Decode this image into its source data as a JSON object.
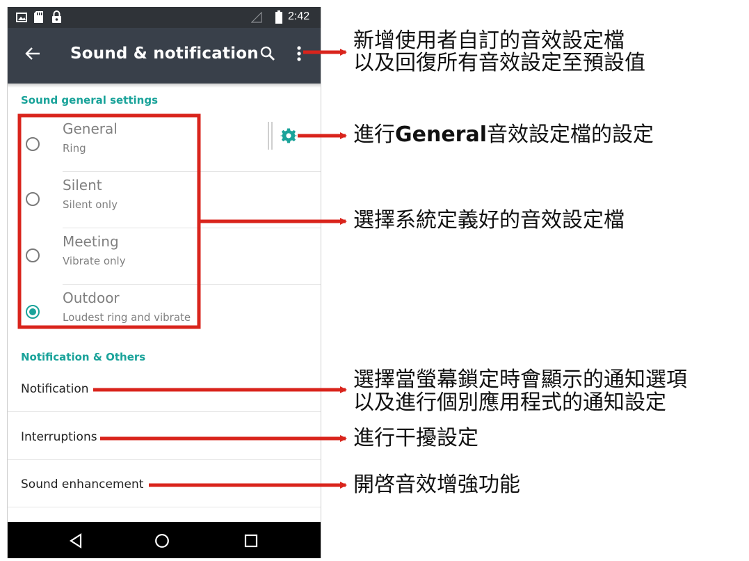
{
  "status_bar": {
    "time": "2:42"
  },
  "toolbar": {
    "title": "Sound & notification",
    "back_icon": "arrow-left-icon",
    "search_icon": "search-icon",
    "overflow_icon": "more-vert-icon"
  },
  "sound_general": {
    "header": "Sound general settings",
    "profiles": [
      {
        "title": "General",
        "subtitle": "Ring",
        "selected": false
      },
      {
        "title": "Silent",
        "subtitle": "Silent only",
        "selected": false
      },
      {
        "title": "Meeting",
        "subtitle": "Vibrate only",
        "selected": false
      },
      {
        "title": "Outdoor",
        "subtitle": "Loudest ring and vibrate",
        "selected": true
      }
    ]
  },
  "notification_others": {
    "header": "Notification & Others",
    "items": [
      "Notification",
      "Interruptions",
      "Sound enhancement"
    ]
  },
  "callouts": {
    "overflow_line1": "新增使用者自訂的音效設定檔",
    "overflow_line2": "以及回復所有音效設定至預設值",
    "general_prefix": "進行",
    "general_bold": "General",
    "general_suffix": "音效設定檔的設定",
    "profiles": "選擇系統定義好的音效設定檔",
    "notification_line1": "選擇當螢幕鎖定時會顯示的通知選項",
    "notification_line2": "以及進行個別應用程式的通知設定",
    "interruptions": "進行干擾設定",
    "enhancement": "開啓音效增強功能"
  },
  "colors": {
    "accent": "#1aa39a",
    "annotation_red": "#d9241c",
    "toolbar": "#39404a"
  }
}
